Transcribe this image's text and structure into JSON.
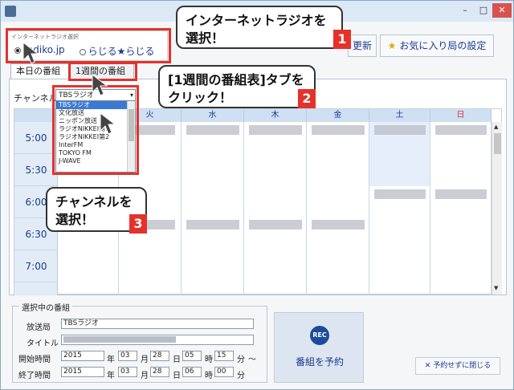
{
  "window": {
    "min_label": "–",
    "max_label": "□",
    "close_label": "✕"
  },
  "radio_group": {
    "legend": "インターネットラジオ選択",
    "options": [
      "radiko.jp",
      "らじる★らじる"
    ],
    "selected": "radiko.jp"
  },
  "toolbar": {
    "update_label": "更新",
    "favorites_label": "お気に入り局の設定"
  },
  "tabs": {
    "today": "本日の番組表",
    "week": "1週間の番組表"
  },
  "channel": {
    "label": "チャンネル",
    "selected": "TBSラジオ",
    "options": [
      "TBSラジオ",
      "文化放送",
      "ニッポン放送",
      "ラジオNIKKEI第1",
      "ラジオNIKKEI第2",
      "InterFM",
      "TOKYO FM",
      "J-WAVE"
    ]
  },
  "schedule": {
    "days": [
      "火",
      "水",
      "木",
      "金",
      "土",
      "日"
    ],
    "times": [
      "5:00",
      "5:30",
      "6:00",
      "6:30",
      "7:00"
    ]
  },
  "callouts": {
    "c1": "インターネットラジオを選択！",
    "c1_num": "1",
    "c2": "[1週間の番組表]タブをクリック！",
    "c2_num": "2",
    "c3": "チャンネルを選択！",
    "c3_num": "3"
  },
  "selected_program": {
    "legend": "選択中の番組",
    "station_label": "放送局",
    "station_value": "TBSラジオ",
    "title_label": "タイトル",
    "start_label": "開始時間",
    "start": {
      "year": "2015",
      "month": "03",
      "day": "28",
      "hour": "05",
      "minute": "15"
    },
    "end_label": "終了時間",
    "end": {
      "year": "2015",
      "month": "03",
      "day": "28",
      "hour": "06",
      "minute": "00"
    },
    "unit_year": "年",
    "unit_month": "月",
    "unit_day": "日",
    "unit_hour": "時",
    "unit_minute": "分",
    "range_mark": "～"
  },
  "rec": {
    "icon_text": "REC",
    "label": "番組を予約"
  },
  "close_without_reserve": "✕ 予約せずに閉じる",
  "colors": {
    "accent": "#1a3b8f",
    "callout_red": "#e4322b"
  }
}
